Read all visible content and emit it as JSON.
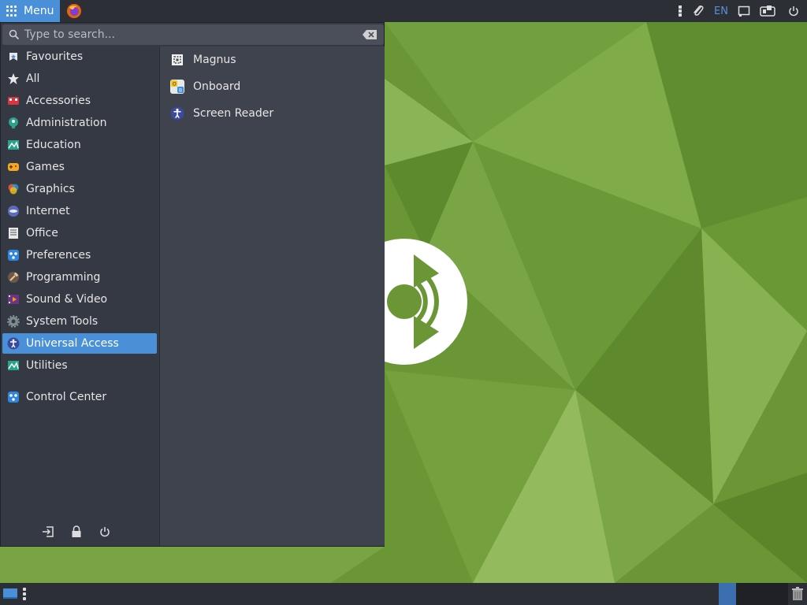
{
  "top_panel": {
    "menu_label": "Menu",
    "tray": {
      "lang": "EN",
      "icons": [
        "drag-handle-icon",
        "paperclip-icon",
        "keyboard-layout-icon",
        "display-icon",
        "notification-icon",
        "power-icon"
      ]
    }
  },
  "search": {
    "placeholder": "Type to search...",
    "value": ""
  },
  "categories": [
    {
      "label": "Favourites",
      "icon": "favourites-icon"
    },
    {
      "label": "All",
      "icon": "star-icon"
    },
    {
      "label": "Accessories",
      "icon": "accessories-icon"
    },
    {
      "label": "Administration",
      "icon": "administration-icon"
    },
    {
      "label": "Education",
      "icon": "education-icon"
    },
    {
      "label": "Games",
      "icon": "games-icon"
    },
    {
      "label": "Graphics",
      "icon": "graphics-icon"
    },
    {
      "label": "Internet",
      "icon": "internet-icon"
    },
    {
      "label": "Office",
      "icon": "office-icon"
    },
    {
      "label": "Preferences",
      "icon": "preferences-icon"
    },
    {
      "label": "Programming",
      "icon": "programming-icon"
    },
    {
      "label": "Sound & Video",
      "icon": "sound-video-icon"
    },
    {
      "label": "System Tools",
      "icon": "system-tools-icon"
    },
    {
      "label": "Universal Access",
      "icon": "universal-access-icon",
      "selected": true
    },
    {
      "label": "Utilities",
      "icon": "utilities-icon"
    }
  ],
  "control_center": {
    "label": "Control Center",
    "icon": "control-center-icon"
  },
  "apps": [
    {
      "label": "Magnus",
      "icon": "magnifier-icon"
    },
    {
      "label": "Onboard",
      "icon": "onboard-keyboard-icon"
    },
    {
      "label": "Screen Reader",
      "icon": "screen-reader-icon"
    }
  ],
  "session_buttons": [
    "logout-icon",
    "lock-icon",
    "power-icon"
  ],
  "colors": {
    "accent": "#4a90d9",
    "panel": "#2c2f36",
    "menu_bg": "#353943",
    "apps_bg": "#3f434d",
    "desktop_green": "#6e9a3a"
  }
}
